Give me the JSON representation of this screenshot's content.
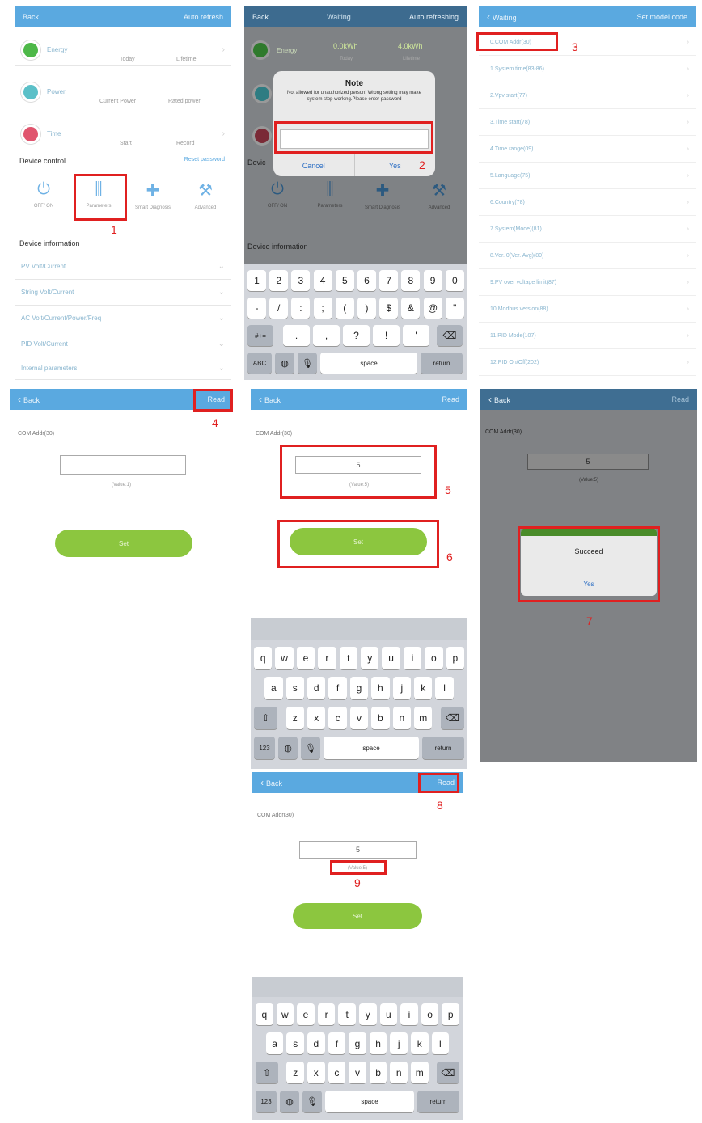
{
  "p1": {
    "nav": {
      "left": "Back",
      "right": "Auto refresh"
    },
    "rows": [
      {
        "label": "Energy",
        "sub1": "Today",
        "sub2": "Lifetime",
        "color": "#4db848"
      },
      {
        "label": "Power",
        "sub1": "Current Power",
        "sub2": "Rated power",
        "color": "#5bc0c8"
      },
      {
        "label": "Time",
        "sub1": "Start",
        "sub2": "Record",
        "color": "#e0556e"
      }
    ],
    "control": {
      "title": "Device control",
      "right": "Reset password"
    },
    "controls": [
      {
        "label": "OFF/ ON",
        "icon": "power-icon",
        "glyph": "⏻"
      },
      {
        "label": "Parameters",
        "icon": "sliders-icon",
        "glyph": "⫼"
      },
      {
        "label": "Smart Diagnosis",
        "icon": "diagnosis-icon",
        "glyph": "✚"
      },
      {
        "label": "Advanced",
        "icon": "tools-icon",
        "glyph": "⚒"
      }
    ],
    "info": {
      "title": "Device information"
    },
    "info_rows": [
      "PV Volt/Current",
      "String Volt/Current",
      "AC Volt/Current/Power/Freq",
      "PID Volt/Current",
      "Internal parameters"
    ]
  },
  "p2": {
    "nav": {
      "left": "Back",
      "mid": "Waiting",
      "right": "Auto refreshing"
    },
    "energy": {
      "label": "Energy",
      "v1": "0.0kWh",
      "v2": "4.0kWh",
      "s1": "Today",
      "s2": "Lifetime"
    },
    "dialog": {
      "title": "Note",
      "message": "Not allowed for unauthorized person! Wrong setting may make system stop working.Please enter password",
      "cancel": "Cancel",
      "yes": "Yes"
    },
    "control_title": "Devic",
    "info_title": "Device information",
    "controls": [
      "OFF/ ON",
      "Parameters",
      "Smart Diagnosis",
      "Advanced"
    ]
  },
  "keyboard_num": {
    "row1": [
      "1",
      "2",
      "3",
      "4",
      "5",
      "6",
      "7",
      "8",
      "9",
      "0"
    ],
    "row2": [
      "-",
      "/",
      ":",
      ";",
      "(",
      ")",
      "$",
      "&",
      "@",
      "\""
    ],
    "row3": [
      ".",
      ",",
      "?",
      "!",
      "'"
    ],
    "abc": "ABC",
    "space": "space",
    "ret": "return",
    "sym": "#+="
  },
  "p3": {
    "nav": {
      "left": "Waiting",
      "right": "Set model code"
    },
    "items": [
      "0.COM Addr(30)",
      "1.System time(83-86)",
      "2.Vpv start(77)",
      "3.Time start(78)",
      "4.Time range(09)",
      "5.Language(75)",
      "6.Country(78)",
      "7.System(Mode)(81)",
      "8.Ver. 0(Ver. Avg)(80)",
      "9.PV over voltage limit(87)",
      "10.Modbus version(88)",
      "11.PID Mode(107)",
      "12.PID On/Off(202)"
    ]
  },
  "p4": {
    "nav": {
      "left": "Back",
      "right": "Read"
    },
    "field_label": "COM Addr(30)",
    "value_hint": "(Value:1)",
    "set": "Set"
  },
  "p5": {
    "nav": {
      "left": "Back",
      "right": "Read"
    },
    "field_label": "COM Addr(30)",
    "value": "5",
    "value_hint": "(Value:5)",
    "set": "Set"
  },
  "p6": {
    "nav": {
      "left": "Back",
      "right": "Read"
    },
    "field_label": "COM Addr(30)",
    "value": "5",
    "value_hint": "(Value:5)",
    "dialog_title": "Succeed",
    "dialog_btn": "Yes"
  },
  "p7": {
    "nav": {
      "left": "Back",
      "right": "Read"
    },
    "field_label": "COM Addr(30)",
    "value": "5",
    "value_hint": "(Value:5)",
    "set": "Set"
  },
  "keyboard_alpha": {
    "row1": [
      "q",
      "w",
      "e",
      "r",
      "t",
      "y",
      "u",
      "i",
      "o",
      "p"
    ],
    "row2": [
      "a",
      "s",
      "d",
      "f",
      "g",
      "h",
      "j",
      "k",
      "l"
    ],
    "row3": [
      "z",
      "x",
      "c",
      "v",
      "b",
      "n",
      "m"
    ],
    "num": "123",
    "space": "space",
    "ret": "return"
  },
  "steps": [
    "1",
    "2",
    "3",
    "4",
    "5",
    "6",
    "7",
    "8",
    "9"
  ]
}
